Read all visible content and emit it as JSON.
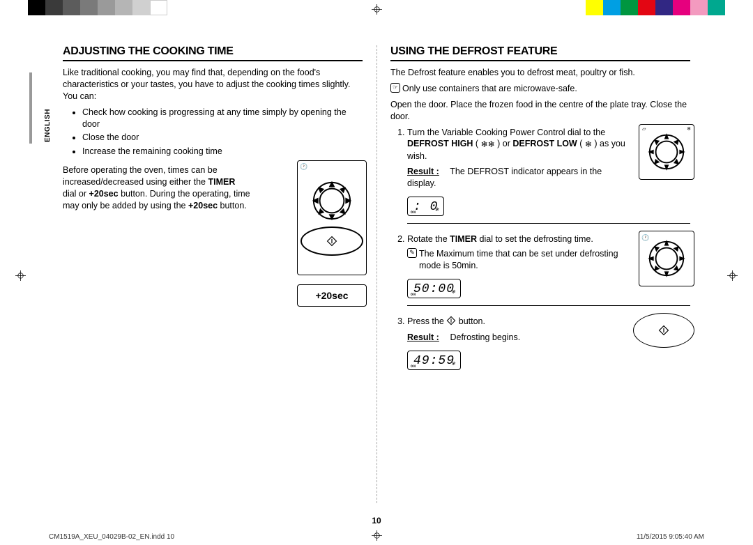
{
  "tab": "ENGLISH",
  "page_number": "10",
  "footer_left": "CM1519A_XEU_04029B-02_EN.indd   10",
  "footer_right": "11/5/2015   9:05:40 AM",
  "left": {
    "heading": "ADJUSTING THE COOKING TIME",
    "intro": "Like traditional cooking, you may find that, depending on the food's characteristics or your tastes, you have to adjust the cooking times slightly. You can:",
    "bullets": [
      "Check how cooking is progressing at any time simply by opening the door",
      "Close the door",
      "Increase the remaining cooking time"
    ],
    "para2a": "Before operating the oven, times can be increased/decreased using either the ",
    "timer_b": "TIMER",
    "para2b": " dial or ",
    "p20_b": "+20sec",
    "para2c": " button. During the operating, time may only be added by using the ",
    "p20_b2": "+20sec",
    "para2d": " button.",
    "plus20_label": "+20sec"
  },
  "right": {
    "heading": "USING THE DEFROST FEATURE",
    "intro": "The Defrost feature enables you to defrost meat, poultry or fish.",
    "note1": "Only use containers that are microwave-safe.",
    "para2": "Open the door. Place the frozen food in the centre of the plate tray. Close the door.",
    "step1a": "Turn the Variable Cooking Power Control dial to the ",
    "def_high": "DEFROST HIGH",
    "step1b": " ( ",
    "step1c": " ) or ",
    "def_low": "DEFROST LOW",
    "step1d": " ( ",
    "step1e": " ) as you wish.",
    "result1_label": "Result :",
    "result1": "The DEFROST indicator appears in the display.",
    "disp1": ":  0",
    "step2a": "Rotate the ",
    "timer_b": "TIMER",
    "step2b": " dial to set the defrosting time.",
    "note2": "The Maximum time that can be set under defrosting mode is 50min.",
    "disp2": "50:00",
    "step3a": "Press the ",
    "step3b": " button.",
    "result3_label": "Result :",
    "result3": "Defrosting begins.",
    "disp3": "49:59"
  }
}
